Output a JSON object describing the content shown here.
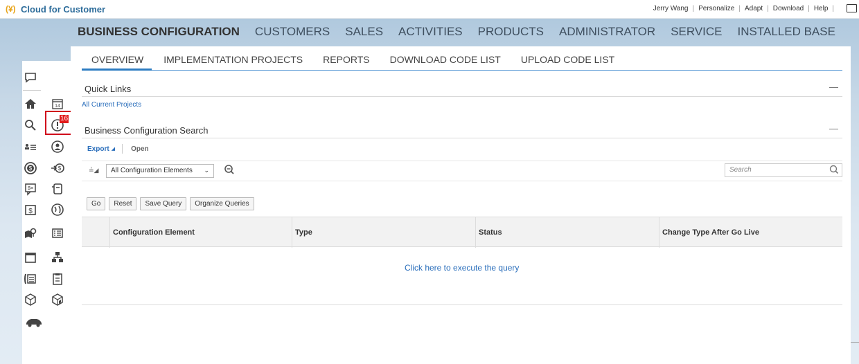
{
  "topbar": {
    "app_title": "Cloud for Customer",
    "user_links": [
      "Jerry Wang",
      "Personalize",
      "Adapt",
      "Download",
      "Help"
    ]
  },
  "main_nav": {
    "items": [
      {
        "label": "BUSINESS CONFIGURATION",
        "active": true
      },
      {
        "label": "CUSTOMERS"
      },
      {
        "label": "SALES"
      },
      {
        "label": "ACTIVITIES"
      },
      {
        "label": "PRODUCTS"
      },
      {
        "label": "ADMINISTRATOR"
      },
      {
        "label": "SERVICE"
      },
      {
        "label": "INSTALLED BASE"
      }
    ]
  },
  "sub_nav": {
    "items": [
      {
        "label": "OVERVIEW",
        "active": true
      },
      {
        "label": "IMPLEMENTATION PROJECTS"
      },
      {
        "label": "REPORTS"
      },
      {
        "label": "DOWNLOAD CODE LIST"
      },
      {
        "label": "UPLOAD CODE LIST"
      }
    ]
  },
  "left_panel": {
    "badge_count": "16",
    "icons": [
      "chat-icon",
      "calendar-14-icon",
      "home-icon",
      "alert-icon",
      "search-icon",
      "user-circle-icon",
      "people-list-icon",
      "money-circle-icon",
      "transfer-money-icon",
      "price-chat-icon",
      "receipt-icon",
      "dollar-doc-icon",
      "globe-icon",
      "map-pin-icon",
      "list-card-icon",
      "calendar-icon",
      "org-chart-icon",
      "phone-list-icon",
      "clipboard-icon",
      "box-icon",
      "package-icon",
      "car-icon"
    ]
  },
  "quick_links": {
    "title": "Quick Links",
    "collapse_symbol": "—",
    "links": [
      "All Current Projects"
    ]
  },
  "search_section": {
    "title": "Business Configuration Search",
    "collapse_symbol": "—",
    "toolbar": {
      "export": "Export",
      "open": "Open"
    },
    "filter_select": "All Configuration Elements",
    "search_placeholder": "Search",
    "buttons": {
      "go": "Go",
      "reset": "Reset",
      "save_query": "Save Query",
      "organize_queries": "Organize Queries"
    },
    "table": {
      "columns": [
        "Configuration Element",
        "Type",
        "Status",
        "Change Type After Go Live"
      ],
      "empty_message": "Click here to execute the query"
    }
  },
  "colors": {
    "accent_blue": "#2a6ebb",
    "highlight_red": "#d0021b",
    "band_blue": "#b0c9de"
  }
}
